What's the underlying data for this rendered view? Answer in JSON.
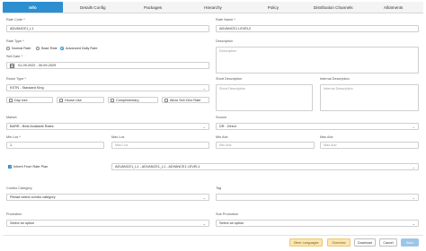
{
  "tabs": [
    "Info",
    "Details Config",
    "Packages",
    "Hierarchy",
    "Policy",
    "Distribution Channels",
    "Allotments"
  ],
  "rate_code": {
    "label": "Rate Code *",
    "value": "ADVANCE1_L1"
  },
  "rate_name": {
    "label": "Rate Name *",
    "value": "ADVANCE1 LEVEL2"
  },
  "rate_type": {
    "label": "Rate Type *",
    "options": [
      "Normal Rate",
      "Base Rate",
      "Advanced Daily Rate"
    ],
    "selected": "Advanced Daily Rate"
  },
  "description": {
    "label": "Description",
    "placeholder": "Description"
  },
  "sell_date": {
    "label": "Sell Date *",
    "value": "01-09-2022 - 30-09-2029"
  },
  "room_type": {
    "label": "Room Type *",
    "value": "KSTN - Standard King"
  },
  "short_description": {
    "label": "Short Description",
    "placeholder": "Short Description"
  },
  "internal_description": {
    "label": "Internal Description",
    "placeholder": "Internal Description"
  },
  "checkboxes": [
    {
      "label": "Day Use",
      "checked": false
    },
    {
      "label": "House Use",
      "checked": false
    },
    {
      "label": "Complimentary",
      "checked": false
    },
    {
      "label": "Allow Sell Zero Rate",
      "checked": false
    }
  ],
  "market": {
    "label": "Market",
    "value": "BARR - Best Available Rates"
  },
  "source": {
    "label": "Source",
    "value": "DR - Direct"
  },
  "min_los": {
    "label": "Min Los *",
    "value": "1"
  },
  "max_los": {
    "label": "Max Los",
    "placeholder": "Max Los"
  },
  "min_adv": {
    "label": "Min Adv",
    "placeholder": "Min Adv"
  },
  "max_adv": {
    "label": "Max Adv",
    "placeholder": "Max Adv"
  },
  "inherit": {
    "label": "Inherit From Rate Plan",
    "checked": true,
    "value": "ADVANCE1_L1 - ADVANCE1_L1 - ADVANCE1 LEVEL1"
  },
  "combo_category": {
    "label": "Combo Category",
    "value": "Please select combo category"
  },
  "tag": {
    "label": "Tag",
    "value": ""
  },
  "promotion": {
    "label": "Promotion",
    "value": "Select an option"
  },
  "sub_promotion": {
    "label": "Sub Promotion",
    "value": "Select an option"
  },
  "buttons": {
    "other_languages": "Other Languages",
    "overview": "Overview",
    "download": "Download",
    "cancel": "Cancel",
    "save": "Save"
  },
  "colors": {
    "accent": "#2c8fd1",
    "warn_bg": "#fbe6b3",
    "primary_disabled": "#9cc6e8"
  }
}
